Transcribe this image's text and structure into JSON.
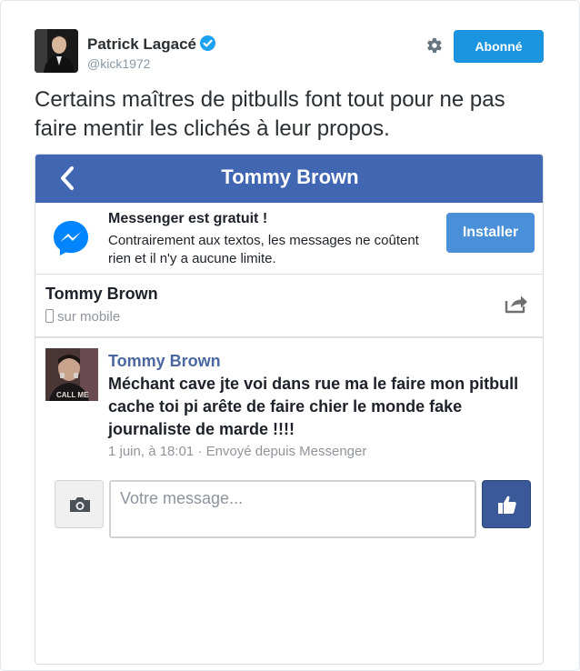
{
  "tweet": {
    "user_name": "Patrick Lagacé",
    "handle": "@kick1972",
    "follow_label": "Abonné",
    "text": "Certains maîtres de pitbulls font tout pour ne pas faire mentir les clichés à leur propos."
  },
  "embed": {
    "header_title": "Tommy Brown",
    "promo": {
      "title": "Messenger est gratuit !",
      "description": "Contrairement aux textos, les messages ne coûtent rien et il n'y a aucune limite.",
      "install_label": "Installer"
    },
    "contact": {
      "name": "Tommy Brown",
      "status": "sur mobile"
    },
    "message": {
      "author": "Tommy Brown",
      "body": "Méchant cave jte voi dans rue ma le faire mon pitbull cache toi pi arête de faire chier le monde fake journaliste de marde !!!!",
      "meta": "1 juin, à 18:01 · Envoyé depuis Messenger",
      "avatar_caption": "CALL ME"
    },
    "composer": {
      "placeholder": "Votre message..."
    }
  },
  "colors": {
    "facebook_blue": "#4267b2",
    "twitter_blue": "#1b95e0",
    "install_blue": "#4a90d9",
    "author_link": "#4b67a1"
  },
  "icons": [
    "verified-badge-icon",
    "gear-icon",
    "back-chevron-icon",
    "messenger-icon",
    "phone-icon",
    "share-icon",
    "camera-icon",
    "thumbs-up-icon"
  ]
}
